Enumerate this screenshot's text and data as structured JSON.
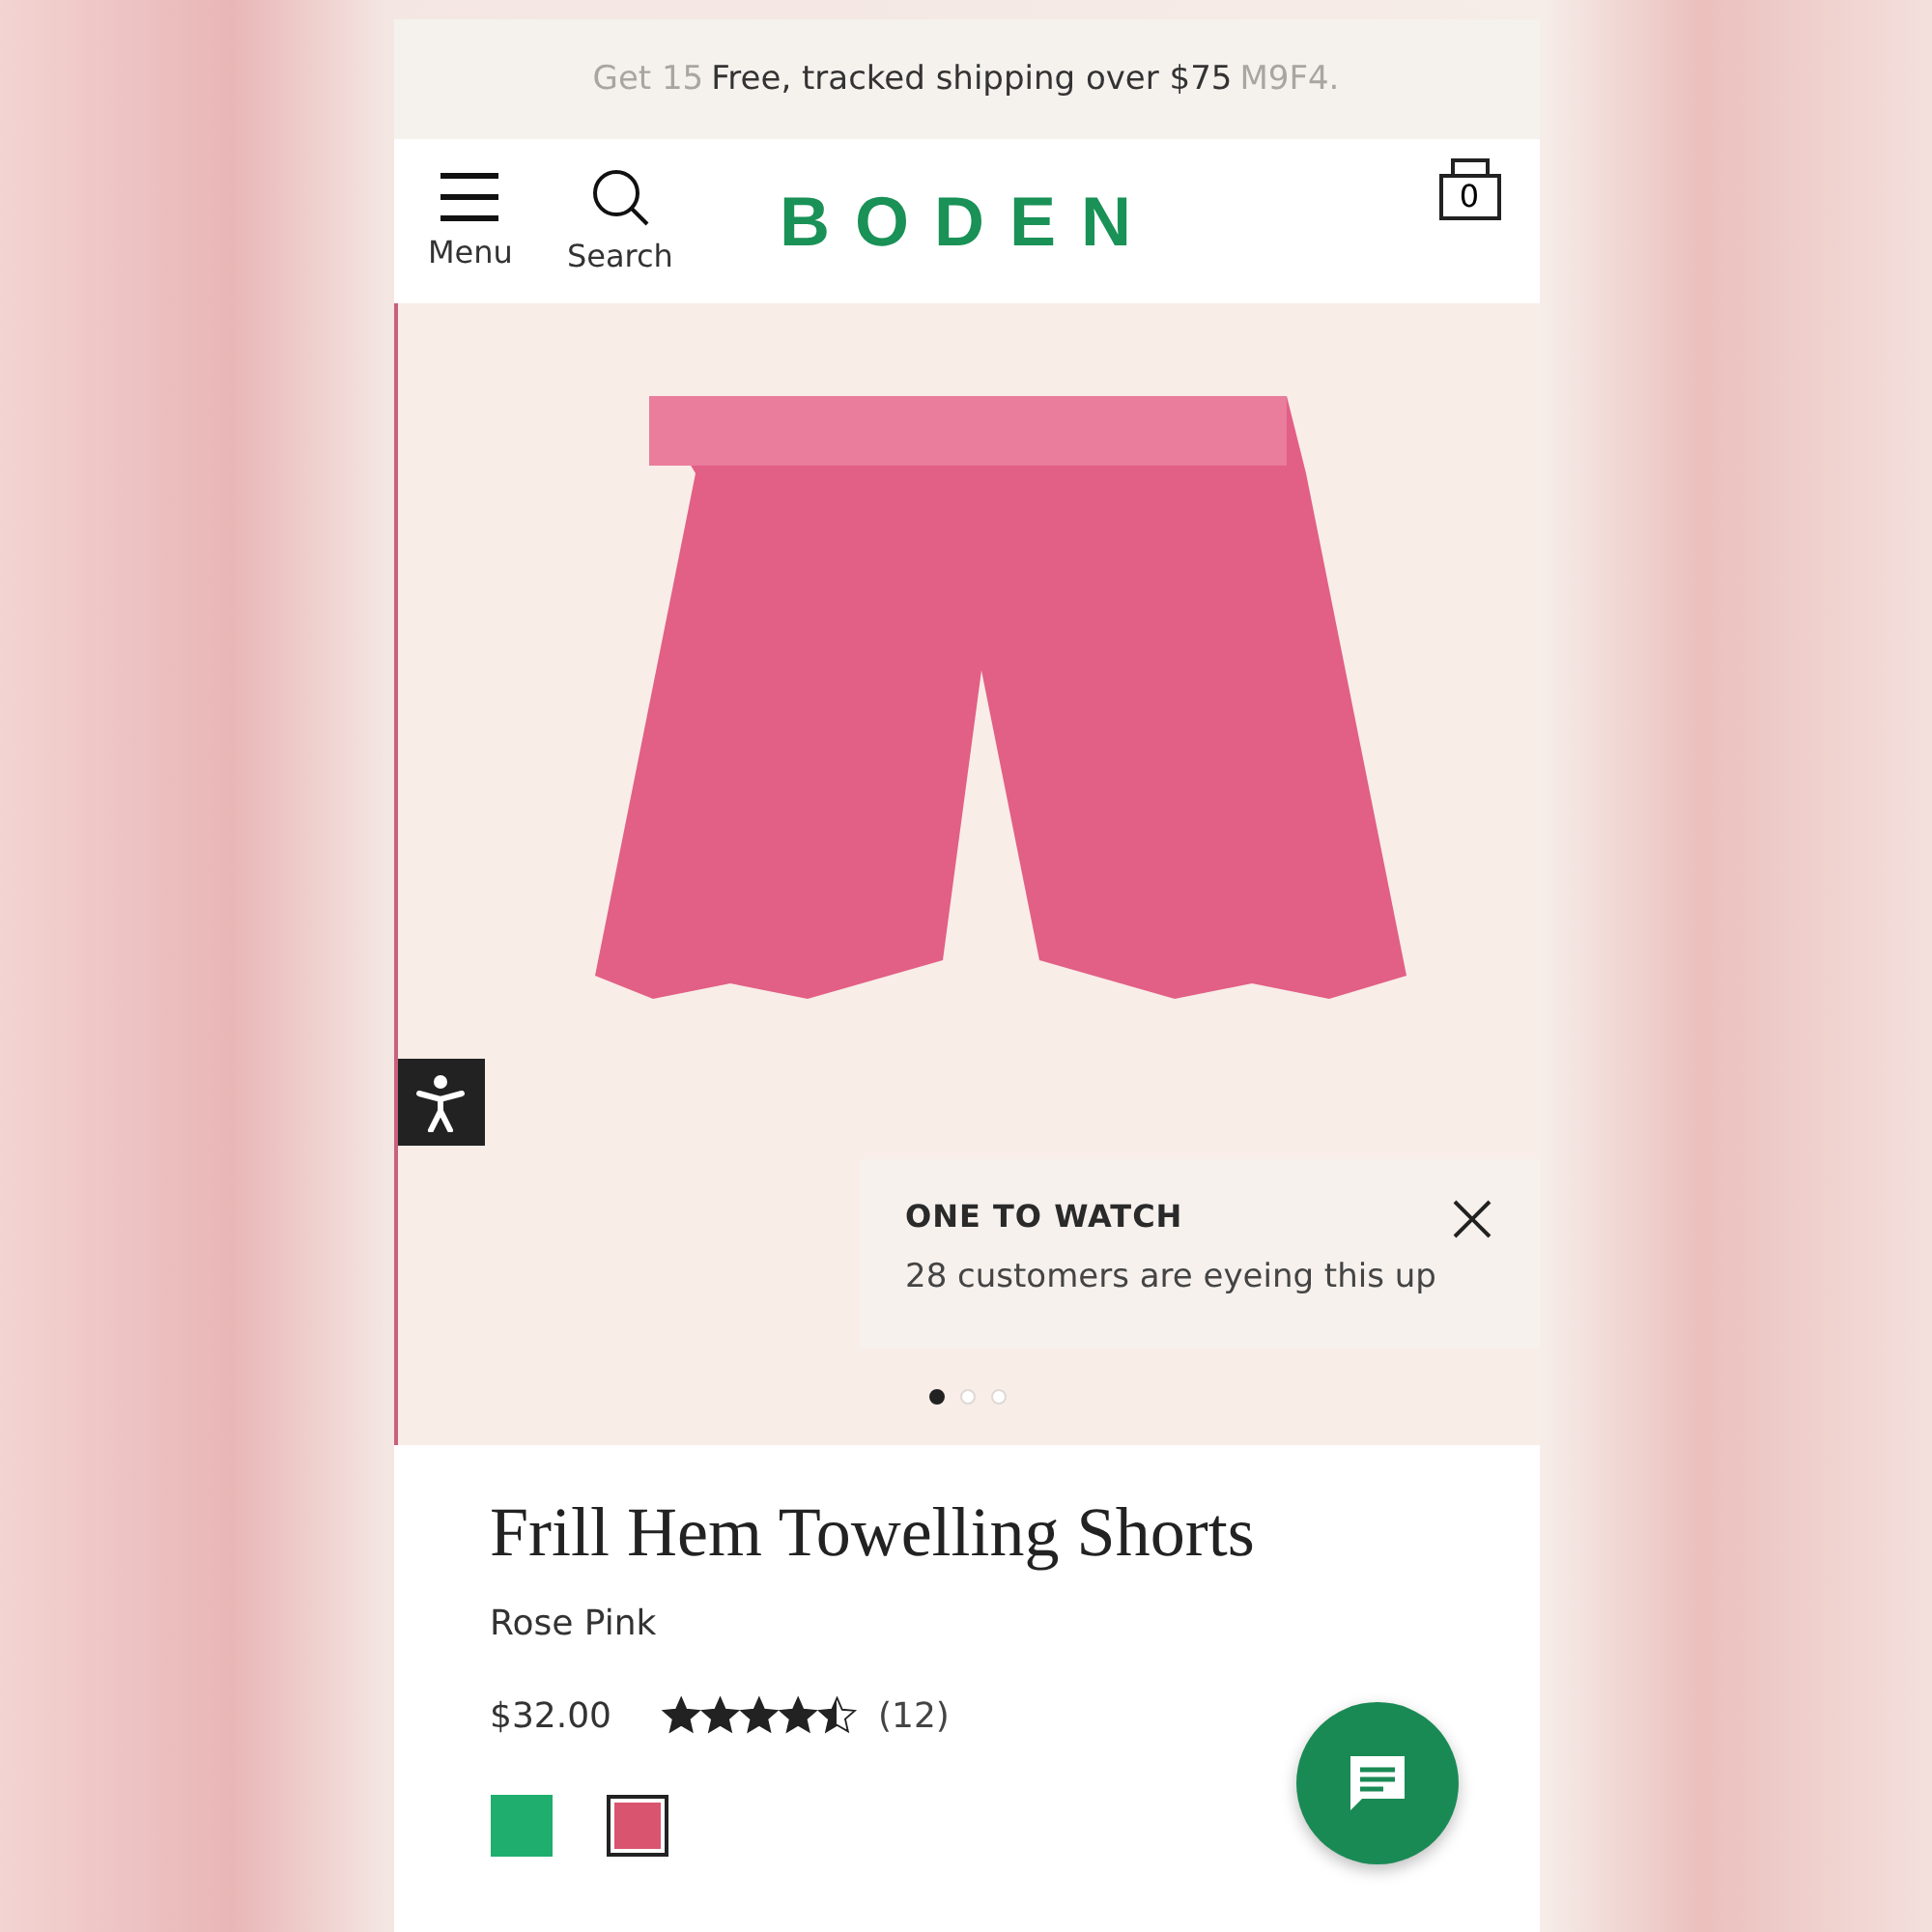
{
  "promo_banner": {
    "text": "Free, tracked shipping over $75",
    "fading_left": "Get 15",
    "fading_right": "M9F4."
  },
  "header": {
    "menu_label": "Menu",
    "search_label": "Search",
    "logo": "BODEN",
    "bag_count": "0"
  },
  "gallery": {
    "dots": [
      {
        "selected": true
      },
      {
        "selected": false
      },
      {
        "selected": false
      }
    ]
  },
  "popup": {
    "title": "ONE TO WATCH",
    "message": "28 customers are eyeing this up"
  },
  "product": {
    "name": "Frill Hem Towelling Shorts",
    "colour_name": "Rose Pink",
    "price": "$32.00",
    "stars": 4.5,
    "review_count": "(12)",
    "swatches": [
      {
        "color": "#1fae6e",
        "selected": false
      },
      {
        "color": "#d9546f",
        "selected": true
      }
    ]
  }
}
